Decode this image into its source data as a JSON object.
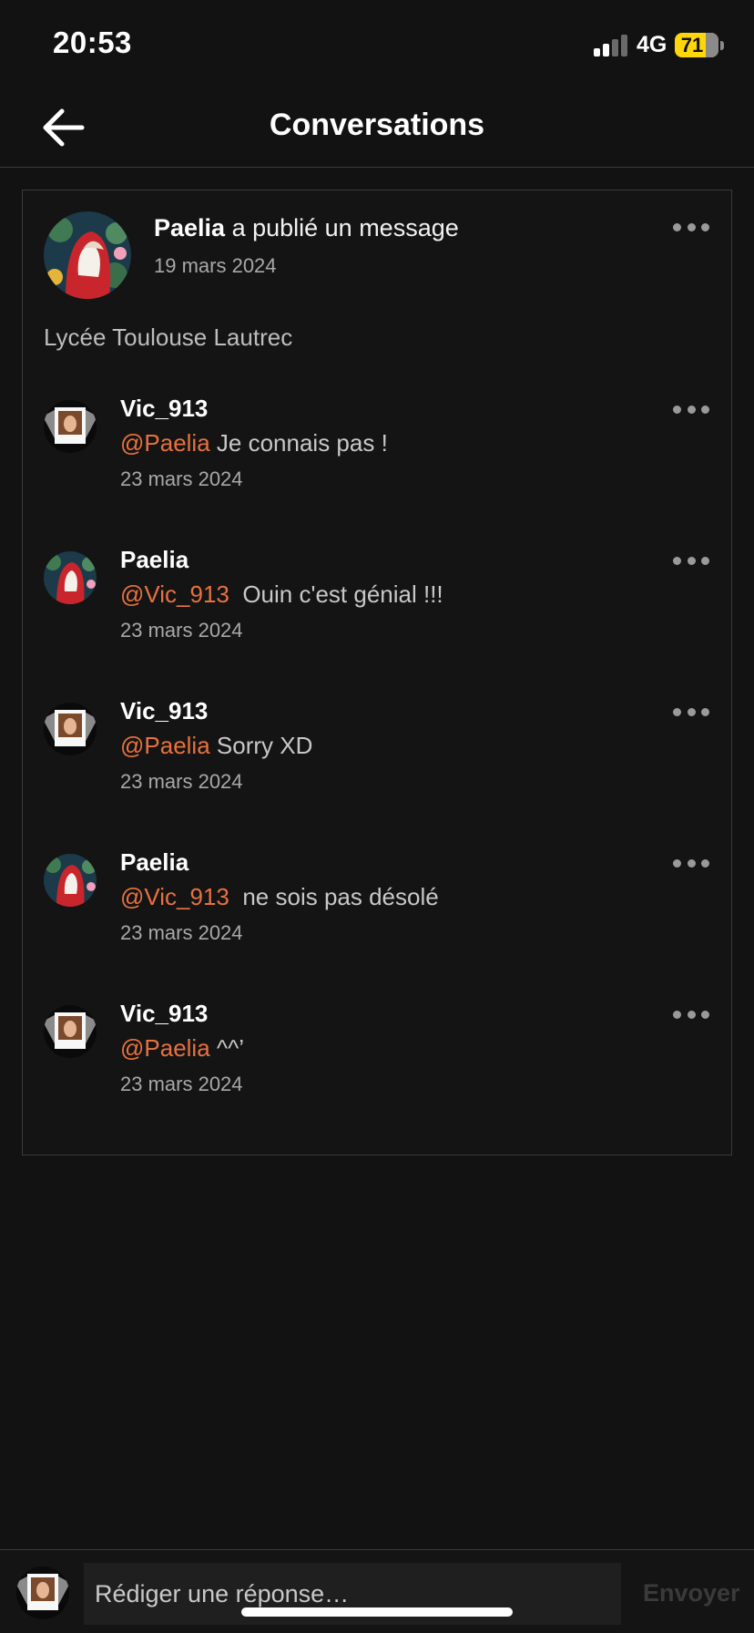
{
  "status_bar": {
    "time": "20:53",
    "network": "4G",
    "battery": "71"
  },
  "header": {
    "title": "Conversations"
  },
  "post": {
    "author": "Paelia",
    "action": "a publié un message",
    "date": "19 mars 2024",
    "text": "Lycée Toulouse Lautrec"
  },
  "replies": [
    {
      "author": "Vic_913",
      "mention": "@Paelia",
      "text": " Je connais pas !",
      "date": "23 mars 2024"
    },
    {
      "author": "Paelia",
      "mention": "@Vic_913",
      "text": "  Ouin c'est génial !!!",
      "date": "23 mars 2024"
    },
    {
      "author": "Vic_913",
      "mention": "@Paelia",
      "text": " Sorry XD",
      "date": "23 mars 2024"
    },
    {
      "author": "Paelia",
      "mention": "@Vic_913",
      "text": "  ne sois pas désolé",
      "date": "23 mars 2024"
    },
    {
      "author": "Vic_913",
      "mention": "@Paelia",
      "text": " ^^’",
      "date": "23 mars 2024"
    }
  ],
  "compose": {
    "placeholder": "Rédiger une réponse…",
    "send_label": "Envoyer"
  },
  "colors": {
    "background": "#121212",
    "mention": "#e8713f",
    "battery": "#ffd60a"
  },
  "icons": {
    "back": "arrow-left-icon",
    "more": "more-horizontal-icon",
    "signal": "cellular-signal-icon",
    "battery": "battery-icon"
  }
}
